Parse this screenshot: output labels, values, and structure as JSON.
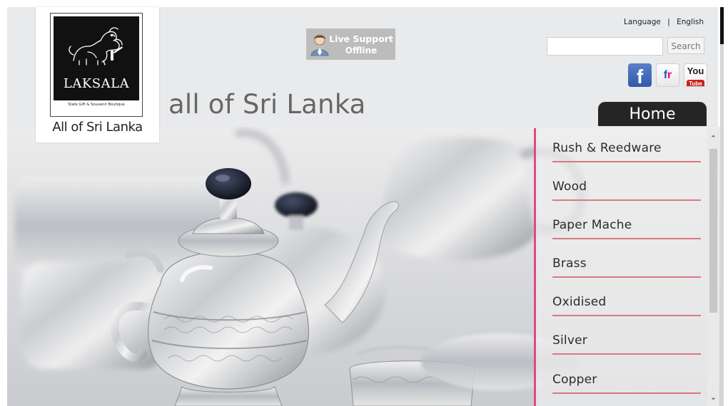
{
  "header": {
    "logo": {
      "name": "LAKSALA",
      "caption": "State Gift & Souvenir Boutique",
      "tagline": "All of Sri Lanka"
    },
    "site_title": "all of Sri Lanka",
    "live_support": {
      "line1": "Live Support",
      "line2": "Offline"
    },
    "language": {
      "label": "Language",
      "separator": "|",
      "value": "English"
    },
    "search": {
      "placeholder": "",
      "value": "",
      "button_label": "Search"
    },
    "social": [
      {
        "name": "facebook-icon",
        "glyph": "f"
      },
      {
        "name": "flickr-icon",
        "glyph_a": "f",
        "glyph_b": "r"
      },
      {
        "name": "youtube-icon",
        "glyph_a": "You",
        "glyph_b": "Tube"
      }
    ],
    "home_tab": "Home"
  },
  "sidebar": {
    "items": [
      "Rush & Reedware",
      "Wood",
      "Paper Mache",
      "Brass",
      "Oxidised",
      "Silver",
      "Copper"
    ]
  },
  "colors": {
    "accent_pink": "#e04887",
    "menu_rule": "#d97880",
    "header_bg": "#e9eaec",
    "home_tab_bg": "#252525",
    "facebook_blue": "#3b5998"
  },
  "scroll": {
    "up_glyph": "⌃",
    "down_glyph": "⌄"
  }
}
